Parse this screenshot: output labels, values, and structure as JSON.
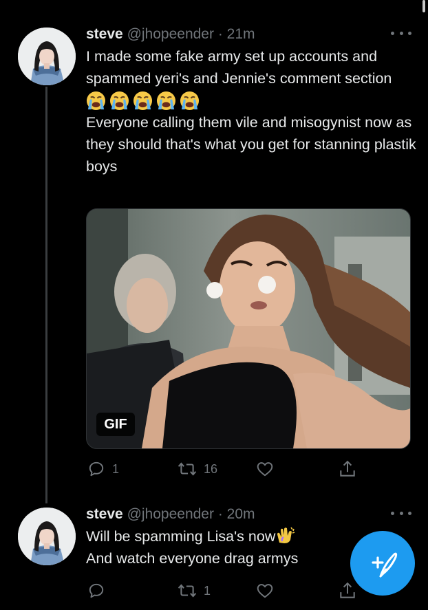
{
  "colors": {
    "background": "#000000",
    "text": "#e7e9ea",
    "muted": "#71767b",
    "accent": "#1d9bf0",
    "thread_line": "#3a3d40"
  },
  "tweets": [
    {
      "display_name": "steve",
      "handle": "@jhopeender",
      "separator": "·",
      "time": "21m",
      "text_lines_1": "I made some fake army set up accounts and spammed yeri's and Jennie's comment section",
      "emoji_row": [
        "loudly-crying-face",
        "loudly-crying-face",
        "loudly-crying-face",
        "loudly-crying-face",
        "loudly-crying-face"
      ],
      "text_lines_2": "Everyone calling them vile and misogynist now as they should that's what you get for stanning plastik boys",
      "media_badge": "GIF",
      "actions": {
        "reply_count": "1",
        "retweet_count": "16",
        "like_count": "",
        "share_icon": "share-icon"
      }
    },
    {
      "display_name": "steve",
      "handle": "@jhopeender",
      "separator": "·",
      "time": "20m",
      "line_1": "Will be spamming Lisa's now",
      "line_1_emoji": "clapping-hands",
      "line_2": "And watch everyone drag armys",
      "actions": {
        "reply_count": "",
        "retweet_count": "1",
        "like_count": "",
        "share_icon": "share-icon"
      }
    }
  ],
  "fab": {
    "icon": "compose-tweet-icon",
    "plus": "+"
  }
}
